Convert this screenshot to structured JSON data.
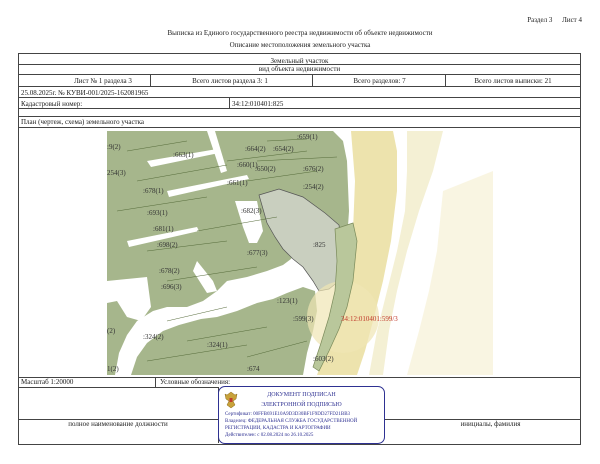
{
  "header": {
    "section": "Раздел 3",
    "sheet": "Лист 4",
    "title": "Выписка из Единого государственного реестра недвижимости об объекте недвижимости",
    "subtitle": "Описание местоположения земельного участка"
  },
  "object": {
    "type": "Земельный участок",
    "kind": "вид объекта недвижимости"
  },
  "meta_row": {
    "sheet_of_section": "Лист № 1 раздела 3",
    "total_sheets_section": "Всего листов раздела 3: 1",
    "total_sections": "Всего разделов: 7",
    "total_sheets_extract": "Всего листов выписки: 21"
  },
  "extract_number": "25.08.2025г. № КУВИ-001/2025-162081965",
  "cadastral": {
    "label": "Кадастровый номер:",
    "value": "34:12:010401:825"
  },
  "plan_label": "План (чертеж, схема) земельного участка",
  "map_labels": {
    "l1": ":9(2)",
    "l2": ":663(1)",
    "l3": ":660(1)",
    "l4": ":664(2)",
    "l5": ":659(1)",
    "l6": ":654(2)",
    "l7": ":650(2)",
    "l8": ":676(2)",
    "l9": ":254(2)",
    "l10": ":678(1)",
    "l11": ":661(1)",
    "l12": ":693(1)",
    "l13": ":681(1)",
    "l14": ":682(3)",
    "l15": ":698(2)",
    "l16": ":677(3)",
    "l17": ":825",
    "l18": ":678(2)",
    "l19": ":696(3)",
    "l20": ":123(1)",
    "l21": ":599(3)",
    "l22": "34:12:010401:599/3",
    "l23": "(2)",
    "l24": ":324(2)",
    "l25": ":324(1)",
    "l26": ":674",
    "l27": ":603(2)",
    "l28": "1(2)",
    "l29": "254(3)"
  },
  "footer": {
    "scale": "Масштаб 1:20000",
    "legend": "Условные обозначения:",
    "position_label": "полное наименование должности",
    "name_label": "инициалы, фамилия"
  },
  "stamp": {
    "line1": "ДОКУМЕНТ ПОДПИСАН",
    "line2": "ЭЛЕКТРОННОЙ ПОДПИСЬЮ",
    "line3": "Сертификат: 00FFB691E10A9D3D30BF1F9DD27FD21BB3",
    "line4": "Владелец: ФЕДЕРАЛЬНАЯ СЛУЖБА ГОСУДАРСТВЕННОЙ",
    "line5": "РЕГИСТРАЦИИ, КАДАСТРА И КАРТОГРАФИИ",
    "line6": "Действителен: с 02.08.2024 по 26.10.2025"
  },
  "colors": {
    "parcel_green": "#a6b68c",
    "river_yellow": "#ede3ad",
    "highlight_red": "#c0392b",
    "stamp_blue": "#2e3192"
  }
}
